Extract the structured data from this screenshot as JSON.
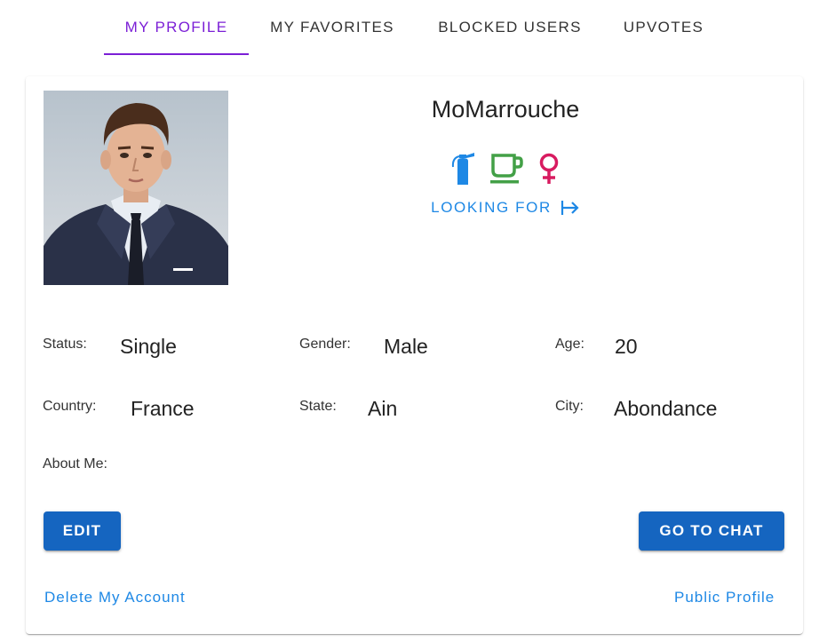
{
  "tabs": [
    {
      "label": "MY PROFILE",
      "active": true
    },
    {
      "label": "MY FAVORITES",
      "active": false
    },
    {
      "label": "BLOCKED USERS",
      "active": false
    },
    {
      "label": "UPVOTES",
      "active": false
    }
  ],
  "profile": {
    "username": "MoMarrouche",
    "icons": [
      {
        "name": "fire-extinguisher-icon",
        "color": "#1e88e5"
      },
      {
        "name": "coffee-cup-icon",
        "color": "#43a047"
      },
      {
        "name": "female-symbol-icon",
        "color": "#d81b60"
      }
    ],
    "looking_for_label": "LOOKING FOR",
    "looking_for_icon": "arrow-right-to-bar-icon"
  },
  "details": {
    "status": {
      "label": "Status:",
      "value": "Single"
    },
    "gender": {
      "label": "Gender:",
      "value": "Male"
    },
    "age": {
      "label": "Age:",
      "value": "20"
    },
    "country": {
      "label": "Country:",
      "value": "France"
    },
    "state": {
      "label": "State:",
      "value": "Ain"
    },
    "city": {
      "label": "City:",
      "value": "Abondance"
    },
    "about": {
      "label": "About Me:",
      "value": ""
    }
  },
  "actions": {
    "edit_label": "EDIT",
    "chat_label": "GO TO CHAT",
    "delete_label": "Delete My Account",
    "public_label": "Public Profile"
  },
  "colors": {
    "accent_tab": "#7b1fd6",
    "button": "#1565c0",
    "link": "#1e88e5"
  }
}
